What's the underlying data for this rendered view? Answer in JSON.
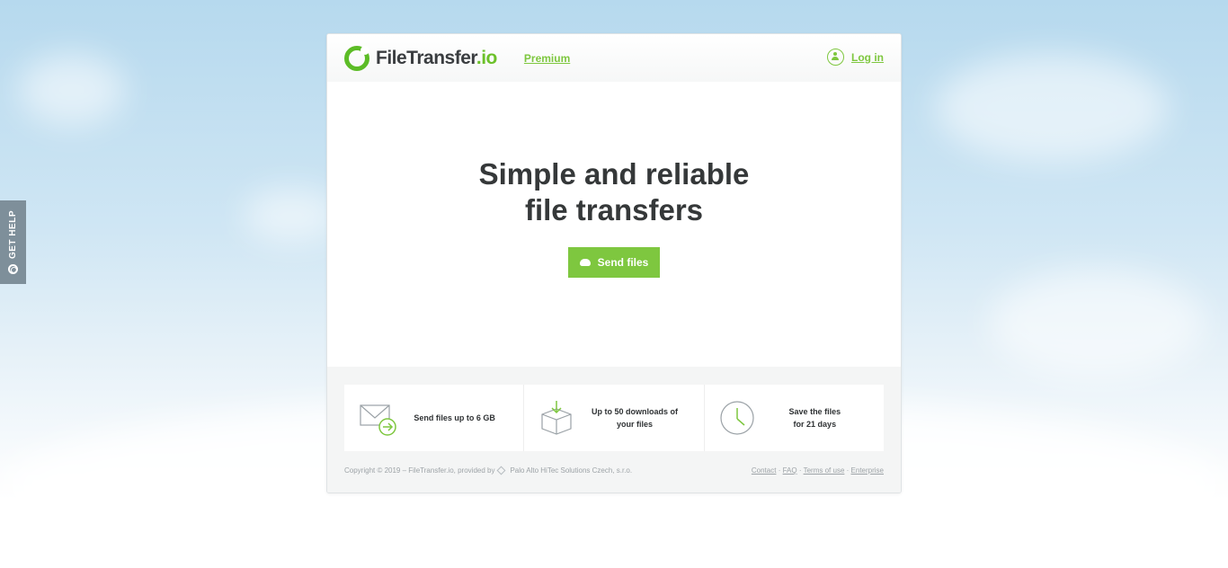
{
  "help_tab": {
    "label": "GET HELP",
    "icon": "lifebuoy-icon"
  },
  "header": {
    "logo_name": "FileTransfer",
    "logo_tld": ".io",
    "premium_label": "Premium",
    "login_label": "Log in",
    "login_icon": "user-icon"
  },
  "hero": {
    "title_line1": "Simple and reliable",
    "title_line2": "file transfers",
    "send_button_label": "Send files",
    "send_button_icon": "cloud-upload-icon"
  },
  "features": [
    {
      "icon": "envelope-arrow-icon",
      "text_line1": "Send files up to 6 GB",
      "text_line2": ""
    },
    {
      "icon": "box-download-icon",
      "text_line1": "Up to 50 downloads of",
      "text_line2": "your files"
    },
    {
      "icon": "clock-icon",
      "text_line1": "Save the files",
      "text_line2": "for 21 days"
    }
  ],
  "footer": {
    "copyright": "Copyright © 2019 – FileTransfer.io, provided by",
    "provider": "Palo Alto HiTec Solutions Czech, s.r.o.",
    "links": [
      "Contact",
      "FAQ",
      "Terms of use",
      "Enterprise"
    ],
    "separator": "·"
  },
  "colors": {
    "accent": "#7ec73f",
    "logo_green": "#5cbc26",
    "help_tab": "#7e8f9a",
    "text_dark": "#353839"
  }
}
